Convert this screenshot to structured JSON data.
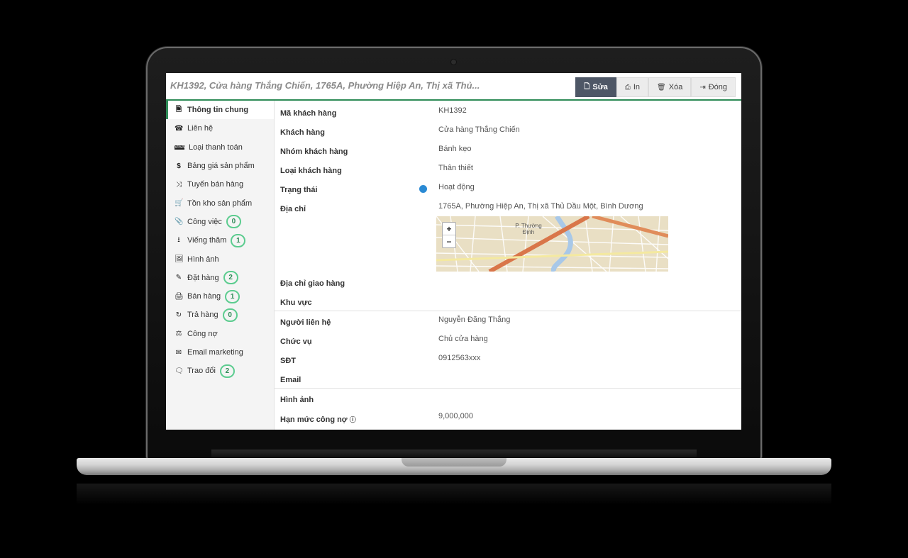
{
  "header": {
    "title": "KH1392, Cửa hàng Thắng Chiến, 1765A, Phường Hiệp An, Thị xã Thủ...",
    "buttons": [
      {
        "label": "Sửa",
        "icon": "file-icon"
      },
      {
        "label": "In",
        "icon": "print-icon"
      },
      {
        "label": "Xóa",
        "icon": "trash-icon"
      },
      {
        "label": "Đóng",
        "icon": "sign-out-icon"
      }
    ]
  },
  "sidebar": {
    "items": [
      {
        "label": "Thông tin chung",
        "icon": "document-icon"
      },
      {
        "label": "Liên hệ",
        "icon": "phone-icon"
      },
      {
        "label": "Loại thanh toán",
        "icon": "visa-card-icon"
      },
      {
        "label": "Bảng giá sản phẩm",
        "icon": "dollar-icon"
      },
      {
        "label": "Tuyến bán hàng",
        "icon": "shuffle-icon"
      },
      {
        "label": "Tồn kho sản phẩm",
        "icon": "cart-icon"
      },
      {
        "label": "Công việc",
        "icon": "paperclip-icon",
        "badge": "0"
      },
      {
        "label": "Viếng thăm",
        "icon": "download-icon",
        "badge": "1"
      },
      {
        "label": "Hình ảnh",
        "icon": "image-icon"
      },
      {
        "label": "Đặt hàng",
        "icon": "edit-icon",
        "badge": "2"
      },
      {
        "label": "Bán hàng",
        "icon": "fax-icon",
        "badge": "1"
      },
      {
        "label": "Trả hàng",
        "icon": "refresh-icon",
        "badge": "0"
      },
      {
        "label": "Công nợ",
        "icon": "balance-scale-icon"
      },
      {
        "label": "Email marketing",
        "icon": "envelope-icon"
      },
      {
        "label": "Trao đổi",
        "icon": "comments-icon",
        "badge": "2"
      }
    ]
  },
  "fields": {
    "ma_kh": {
      "label": "Mã khách hàng",
      "value": "KH1392"
    },
    "khach_hang": {
      "label": "Khách hàng",
      "value": "Cửa hàng Thắng Chiến"
    },
    "nhom_kh": {
      "label": "Nhóm khách hàng",
      "value": "Bánh kẹo"
    },
    "loai_kh": {
      "label": "Loại khách hàng",
      "value": "Thân thiết"
    },
    "trang_thai": {
      "label": "Trạng thái",
      "value": "Hoạt động",
      "dot_color": "#2a8ad4"
    },
    "dia_chi": {
      "label": "Địa chỉ",
      "value": "1765A, Phường Hiệp An, Thị xã Thủ Dầu Một, Bình Dương"
    },
    "dia_chi_gh": {
      "label": "Địa chỉ giao hàng",
      "value": ""
    },
    "khu_vuc": {
      "label": "Khu vực",
      "value": ""
    },
    "nguoi_lien_he": {
      "label": "Người liên hệ",
      "value": "Nguyễn Đăng Thắng"
    },
    "chuc_vu": {
      "label": "Chức vụ",
      "value": "Chủ cửa hàng"
    },
    "sdt": {
      "label": "SĐT",
      "value": "0912563xxx"
    },
    "email": {
      "label": "Email",
      "value": ""
    },
    "hinh_anh": {
      "label": "Hình ảnh",
      "value": ""
    },
    "han_muc": {
      "label": "Hạn mức công nợ",
      "value": "9,000,000"
    }
  },
  "map": {
    "zoom_in": "+",
    "zoom_out": "−",
    "label_line1": "P. Thường",
    "label_line2": "Định"
  },
  "colors": {
    "accent": "#2e8b57",
    "primary_button": "#4e5766",
    "badge_border": "#5ccc8f"
  }
}
